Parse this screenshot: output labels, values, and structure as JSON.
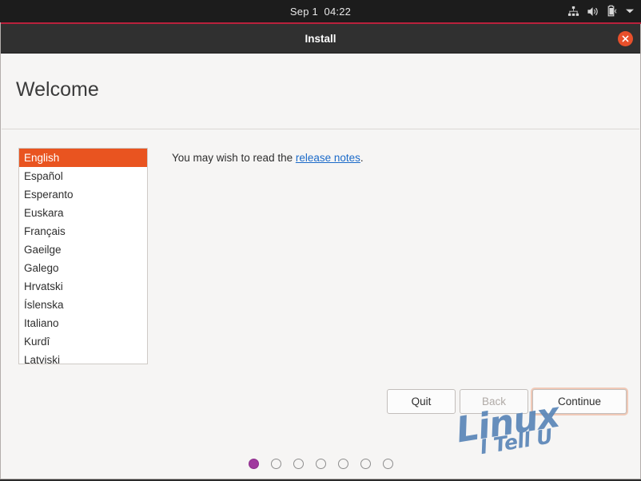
{
  "panel": {
    "clock": "Sep 1  04:22",
    "indicators": [
      {
        "name": "network-icon"
      },
      {
        "name": "volume-icon"
      },
      {
        "name": "battery-icon"
      },
      {
        "name": "chevron-down-icon"
      }
    ]
  },
  "window": {
    "title": "Install",
    "close_label": "×"
  },
  "page": {
    "title": "Welcome"
  },
  "languages": [
    {
      "label": "English",
      "selected": true
    },
    {
      "label": "Español",
      "selected": false
    },
    {
      "label": "Esperanto",
      "selected": false
    },
    {
      "label": "Euskara",
      "selected": false
    },
    {
      "label": "Français",
      "selected": false
    },
    {
      "label": "Gaeilge",
      "selected": false
    },
    {
      "label": "Galego",
      "selected": false
    },
    {
      "label": "Hrvatski",
      "selected": false
    },
    {
      "label": "Íslenska",
      "selected": false
    },
    {
      "label": "Italiano",
      "selected": false
    },
    {
      "label": "Kurdî",
      "selected": false
    },
    {
      "label": "Latviski",
      "selected": false
    }
  ],
  "release_note": {
    "prefix": "You may wish to read the ",
    "link_text": "release notes",
    "suffix": "."
  },
  "buttons": {
    "quit": "Quit",
    "back": "Back",
    "continue": "Continue"
  },
  "watermark": {
    "main": "Linux",
    "sub": "I Tell U"
  },
  "progress": {
    "total": 7,
    "current": 1
  },
  "colors": {
    "ubuntu_orange": "#e95420",
    "link_blue": "#1b6ac9",
    "dot_active": "#a0399e",
    "titlebar": "#303030",
    "panel": "#1c1c1c",
    "window_bg": "#f6f5f4",
    "accent_line": "#b9213c",
    "close_button": "#e8502b"
  }
}
